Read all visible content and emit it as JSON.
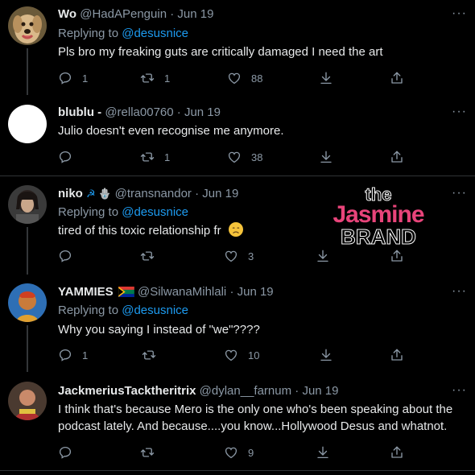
{
  "tweets": [
    {
      "name": "Wo",
      "handle": "@HadAPenguin",
      "date": "· Jun 19",
      "replying_prefix": "Replying to",
      "replying_to": "@desusnice",
      "text": "Pls bro my freaking guts are critically damaged I need the art",
      "replies": "1",
      "retweets": "1",
      "likes": "88"
    },
    {
      "name": "blublu -",
      "handle": "@rella00760",
      "date": "· Jun 19",
      "text": "Julio doesn't even recognise me anymore.",
      "replies": "",
      "retweets": "1",
      "likes": "38"
    },
    {
      "name": "niko",
      "name_emoji": "☭ 🪬",
      "handle": "@transnandor",
      "date": "· Jun 19",
      "replying_prefix": "Replying to",
      "replying_to": "@desusnice",
      "text": "tired of this toxic relationship fr",
      "replies": "",
      "retweets": "",
      "likes": "3"
    },
    {
      "name": "YAMMIES",
      "handle": "@SilwanaMihlali",
      "date": "· Jun 19",
      "replying_prefix": "Replying to",
      "replying_to": "@desusnice",
      "text": "Why you saying I instead of \"we\"????",
      "replies": "1",
      "retweets": "",
      "likes": "10"
    },
    {
      "name": "JackmeriusTacktheritrix",
      "handle": "@dylan__farnum",
      "date": "· Jun 19",
      "text": "I think that's because Mero is the only one who's been speaking about the podcast lately. And because....you know...Hollywood Desus and whatnot.",
      "replies": "",
      "retweets": "",
      "likes": "9"
    }
  ],
  "watermark": {
    "line1": "the",
    "line2": "Jasmine",
    "line3": "BRAND"
  },
  "more_label": "···",
  "icons": {
    "reply": "reply-icon",
    "retweet": "retweet-icon",
    "like": "heart-icon",
    "share": "share-icon",
    "upload": "upload-icon"
  },
  "colors": {
    "background": "#000000",
    "text": "#e7e9ea",
    "muted": "#8b98a5",
    "link": "#1d9bf0",
    "watermark_pink": "#e8447a"
  }
}
